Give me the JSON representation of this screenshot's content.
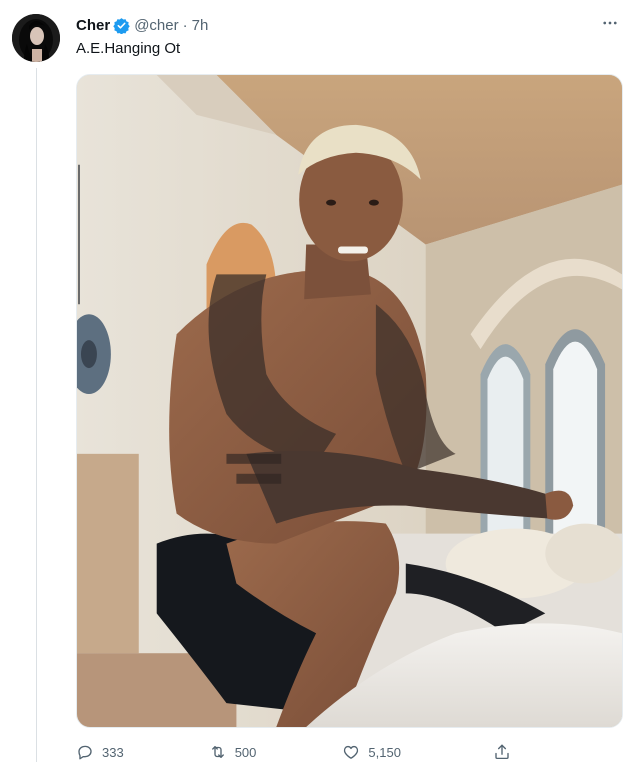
{
  "tweet": {
    "author": {
      "name": "Cher",
      "handle": "@cher",
      "separator": "·",
      "time": "7h",
      "verified": true,
      "verified_color": "#1d9bf0"
    },
    "text": "A.E.Hanging Ot",
    "more_icon": "more-horizontal-icon",
    "media": {
      "alt": "Shirtless tattooed man with bleached hair kneeling on a white bed in a Spanish-style room with arched windows"
    },
    "actions": {
      "reply": {
        "count": "333",
        "icon": "reply-icon"
      },
      "retweet": {
        "count": "500",
        "icon": "retweet-icon"
      },
      "like": {
        "count": "5,150",
        "icon": "heart-icon"
      },
      "share": {
        "icon": "share-icon"
      }
    }
  },
  "colors": {
    "text_primary": "#0f1419",
    "text_secondary": "#536471",
    "border": "#e6ecf0"
  }
}
